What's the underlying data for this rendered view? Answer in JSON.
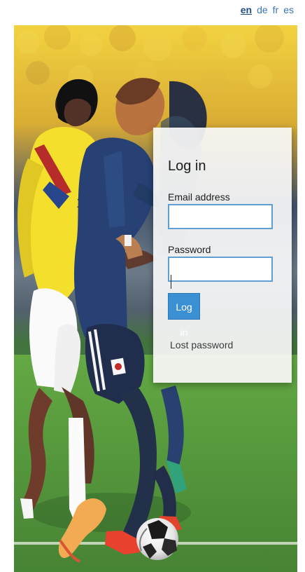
{
  "languages": [
    {
      "code": "en",
      "label": "en",
      "active": true
    },
    {
      "code": "de",
      "label": "de",
      "active": false
    },
    {
      "code": "fr",
      "label": "fr",
      "active": false
    },
    {
      "code": "es",
      "label": "es",
      "active": false
    }
  ],
  "login": {
    "title": "Log in",
    "email_label": "Email address",
    "email_value": "",
    "password_label": "Password",
    "password_value": "",
    "button_label": "Log in",
    "lost_password_label": "Lost password"
  },
  "colors": {
    "link": "#3a76b7",
    "active_link": "#1f4f8a",
    "button": "#3b8fd3",
    "input_border": "#5f9fd3",
    "card": "#f8f8f8"
  },
  "hero": {
    "icon": "soccer-action-photo-icon"
  }
}
